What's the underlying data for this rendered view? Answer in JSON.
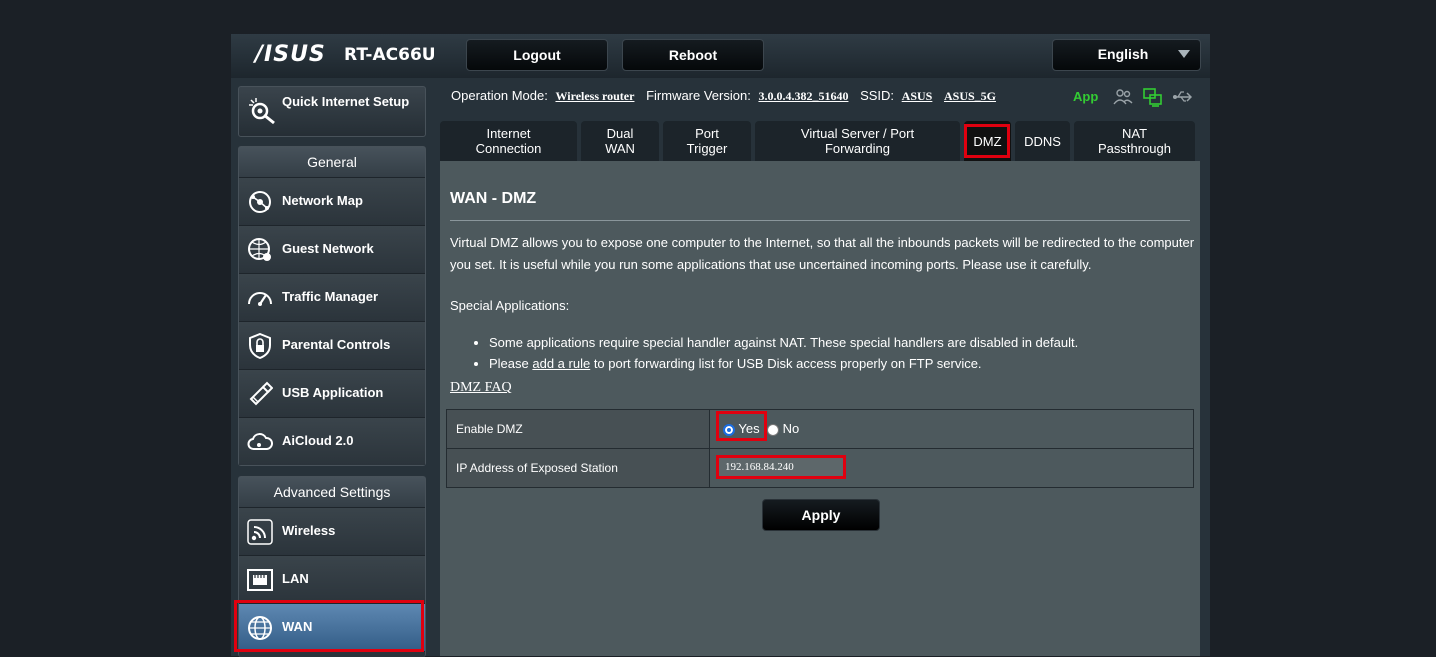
{
  "header": {
    "brand": "/ISUS",
    "model": "RT-AC66U",
    "logout_label": "Logout",
    "reboot_label": "Reboot",
    "language": "English"
  },
  "sidebar": {
    "quick_setup_label": "Quick Internet Setup",
    "general_heading": "General",
    "general_items": [
      {
        "label": "Network Map",
        "icon": "network-map-icon"
      },
      {
        "label": "Guest Network",
        "icon": "guest-network-icon"
      },
      {
        "label": "Traffic Manager",
        "icon": "speedometer-icon"
      },
      {
        "label": "Parental Controls",
        "icon": "parental-lock-icon"
      },
      {
        "label": "USB Application",
        "icon": "usb-icon"
      },
      {
        "label": "AiCloud 2.0",
        "icon": "cloud-icon"
      }
    ],
    "advanced_heading": "Advanced Settings",
    "advanced_items": [
      {
        "label": "Wireless",
        "icon": "wireless-icon"
      },
      {
        "label": "LAN",
        "icon": "lan-icon"
      },
      {
        "label": "WAN",
        "icon": "globe-icon"
      }
    ],
    "active_item": "WAN"
  },
  "status": {
    "operation_mode_label": "Operation Mode:",
    "operation_mode_value": "Wireless router",
    "firmware_label": "Firmware Version:",
    "firmware_value": "3.0.0.4.382_51640",
    "ssid_label": "SSID:",
    "ssid_values": [
      "ASUS",
      "ASUS_5G"
    ],
    "app_label": "App"
  },
  "tabs": [
    {
      "label": "Internet Connection"
    },
    {
      "label": "Dual WAN"
    },
    {
      "label": "Port Trigger"
    },
    {
      "label": "Virtual Server / Port Forwarding"
    },
    {
      "label": "DMZ"
    },
    {
      "label": "DDNS"
    },
    {
      "label": "NAT Passthrough"
    }
  ],
  "selected_tab": "DMZ",
  "page": {
    "title": "WAN - DMZ",
    "description": "Virtual DMZ allows you to expose one computer to the Internet, so that all the inbounds packets will be redirected to the computer you set. It is useful while you run some applications that use uncertained incoming ports. Please use it carefully.",
    "special_heading": "Special Applications:",
    "bullet_1": "Some applications require special handler against NAT. These special handlers are disabled in default.",
    "bullet_2_prefix": "Please ",
    "bullet_2_link": "add a rule",
    "bullet_2_suffix": " to port forwarding list for USB Disk access properly on FTP service.",
    "faq_link": "DMZ FAQ"
  },
  "form": {
    "enable_dmz_label": "Enable DMZ",
    "yes_label": "Yes",
    "no_label": "No",
    "enable_dmz_value": "Yes",
    "ip_label": "IP Address of Exposed Station",
    "ip_value": "192.168.84.240",
    "apply_label": "Apply"
  },
  "colors": {
    "highlight": "#e0000f",
    "app_green": "#33cc33",
    "active_menu": "#4a76a2"
  }
}
